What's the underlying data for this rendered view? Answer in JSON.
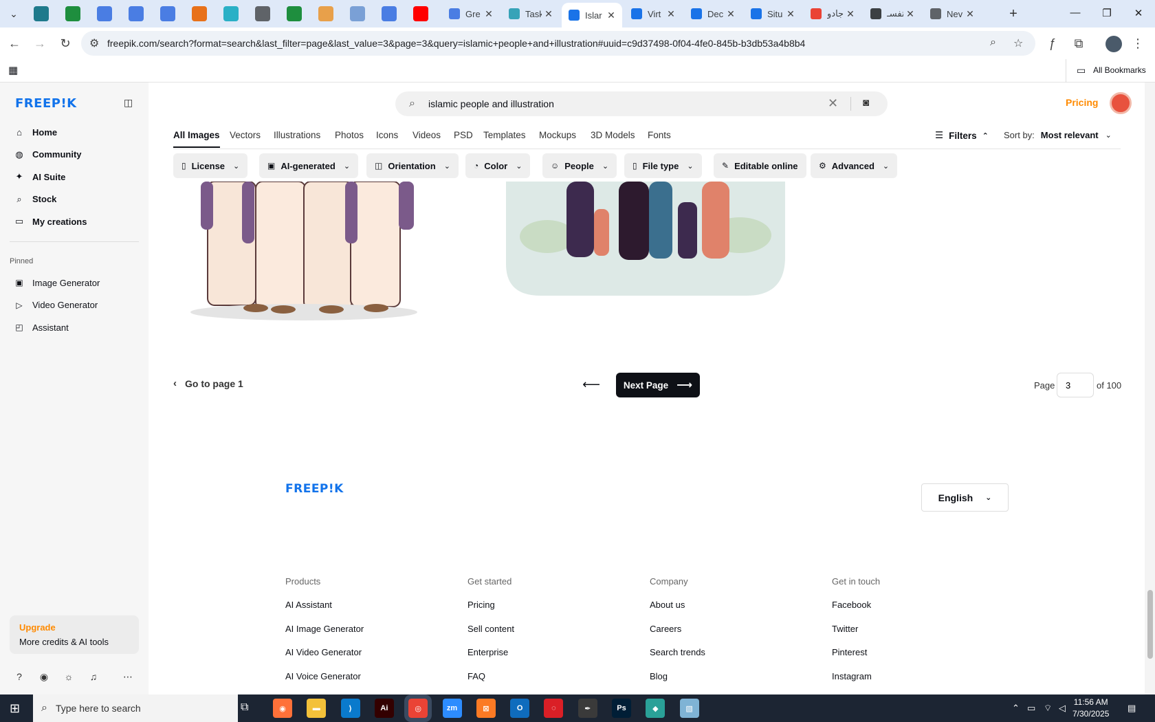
{
  "tabs": [
    {
      "title": "Gre",
      "fav": "#4a7de3"
    },
    {
      "title": "Task",
      "fav": "#37a3b8"
    },
    {
      "title": "Islar",
      "fav": "#1a73e8",
      "active": true
    },
    {
      "title": "Virt",
      "fav": "#1a73e8"
    },
    {
      "title": "Dec",
      "fav": "#1a73e8"
    },
    {
      "title": "Situ",
      "fav": "#1a73e8"
    },
    {
      "title": "جادو",
      "fav": "#ea4335"
    },
    {
      "title": "تفسـ",
      "fav": "#3c4043"
    },
    {
      "title": "Nev",
      "fav": "#5f6368"
    }
  ],
  "pinned_tabs": [
    "#1f7a8c",
    "#1e8e3e",
    "#4a7de3",
    "#4a7de3",
    "#4a7de3",
    "#e8711a",
    "#2ab0c6",
    "#5f6368",
    "#1e8e3e",
    "#e8a04a",
    "#7aa0d6",
    "#4a7de3",
    "#ff0000"
  ],
  "address": {
    "url": "freepik.com/search?format=search&last_filter=page&last_value=3&page=3&query=islamic+people+and+illustration#uuid=c9d37498-0f04-4fe0-845b-b3db53a4b8b4"
  },
  "bookmarks": {
    "all_label": "All Bookmarks"
  },
  "brand": {
    "logo": "FREEP!K",
    "accent": "#1273eb",
    "orange": "#ff8a00"
  },
  "sidebar": {
    "items": [
      {
        "label": "Home",
        "icon": "home-icon",
        "glyph": "⌂"
      },
      {
        "label": "Community",
        "icon": "globe-icon",
        "glyph": "◍"
      },
      {
        "label": "AI Suite",
        "icon": "sparkle-icon",
        "glyph": "✦"
      },
      {
        "label": "Stock",
        "icon": "search-icon",
        "glyph": "⌕"
      },
      {
        "label": "My creations",
        "icon": "folder-icon",
        "glyph": "▭"
      }
    ],
    "pinned_heading": "Pinned",
    "pinned": [
      {
        "label": "Image Generator",
        "icon": "image-icon",
        "glyph": "▣"
      },
      {
        "label": "Video Generator",
        "icon": "video-icon",
        "glyph": "▷"
      },
      {
        "label": "Assistant",
        "icon": "chat-icon",
        "glyph": "◰"
      }
    ],
    "upgrade": {
      "title": "Upgrade",
      "subtitle": "More credits & AI tools"
    }
  },
  "header": {
    "search_value": "islamic people and illustration",
    "pricing": "Pricing"
  },
  "content_tabs": [
    "All Images",
    "Vectors",
    "Illustrations",
    "Photos",
    "Icons",
    "Videos",
    "PSD",
    "Templates",
    "Mockups",
    "3D Models",
    "Fonts"
  ],
  "filters": {
    "label": "Filters",
    "sort_label": "Sort by:",
    "sort_value": "Most relevant"
  },
  "chips": [
    {
      "label": "License",
      "glyph": "▯"
    },
    {
      "label": "AI-generated",
      "glyph": "▣"
    },
    {
      "label": "Orientation",
      "glyph": "◫"
    },
    {
      "label": "Color",
      "glyph": "◔"
    },
    {
      "label": "People",
      "glyph": "☺"
    },
    {
      "label": "File type",
      "glyph": "▯"
    },
    {
      "label": "Editable online",
      "glyph": "✎"
    },
    {
      "label": "Advanced",
      "glyph": "⚙"
    }
  ],
  "pagination": {
    "go_first": "Go to page 1",
    "next": "Next Page",
    "page_label": "Page",
    "current": "3",
    "total_label": "of 100"
  },
  "footer": {
    "logo": "FREEP!K",
    "language": "English",
    "columns": [
      {
        "heading": "Products",
        "links": [
          "AI Assistant",
          "AI Image Generator",
          "AI Video Generator",
          "AI Voice Generator"
        ]
      },
      {
        "heading": "Get started",
        "links": [
          "Pricing",
          "Sell content",
          "Enterprise",
          "FAQ"
        ]
      },
      {
        "heading": "Company",
        "links": [
          "About us",
          "Careers",
          "Search trends",
          "Blog"
        ]
      },
      {
        "heading": "Get in touch",
        "links": [
          "Facebook",
          "Twitter",
          "Pinterest",
          "Instagram"
        ]
      }
    ]
  },
  "taskbar": {
    "search_placeholder": "Type here to search",
    "time": "11:56 AM",
    "date": "7/30/2025",
    "apps": [
      {
        "name": "firefox",
        "color": "#ff7139",
        "glyph": "◉"
      },
      {
        "name": "file-explorer",
        "color": "#f3c13a",
        "glyph": "▬"
      },
      {
        "name": "vscode",
        "color": "#0a7acc",
        "glyph": "⟩"
      },
      {
        "name": "illustrator",
        "color": "#330000",
        "glyph": "Ai"
      },
      {
        "name": "chrome",
        "color": "#ea4335",
        "glyph": "◎"
      },
      {
        "name": "zoom",
        "color": "#2d8cff",
        "glyph": "zm"
      },
      {
        "name": "xampp",
        "color": "#fb7a24",
        "glyph": "⊠"
      },
      {
        "name": "outlook",
        "color": "#0f6cbd",
        "glyph": "O"
      },
      {
        "name": "creative-cloud",
        "color": "#da1f26",
        "glyph": "◌"
      },
      {
        "name": "pen-tool",
        "color": "#3a3a3a",
        "glyph": "✒"
      },
      {
        "name": "photoshop",
        "color": "#001e36",
        "glyph": "Ps"
      },
      {
        "name": "app-diamond",
        "color": "#2aa198",
        "glyph": "◆"
      },
      {
        "name": "app-notepad",
        "color": "#7fb3d5",
        "glyph": "▧"
      }
    ]
  }
}
